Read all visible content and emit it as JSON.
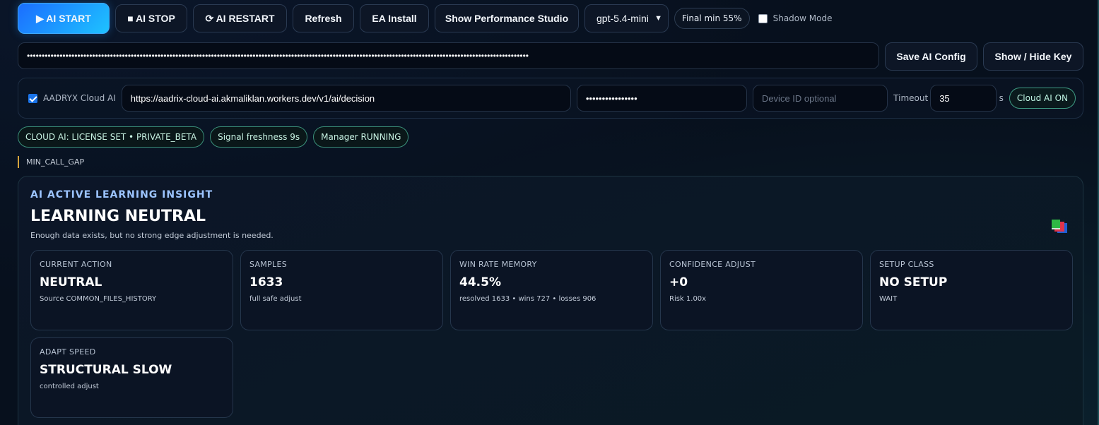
{
  "toolbar": {
    "start_label": "▶ AI START",
    "stop_label": "■ AI STOP",
    "restart_label": "⟳ AI RESTART",
    "refresh_label": "Refresh",
    "ea_install_label": "EA Install",
    "performance_label": "Show Performance Studio",
    "model_select_value": "gpt-5.4-mini",
    "final_min_label": "Final min 55%",
    "shadow_mode_label": "Shadow Mode",
    "shadow_mode_checked": false
  },
  "api_key": {
    "masked_value": "•••••••••••••••••••••••••••••••••••••••••••••••••••••••••••••••••••••••••••••••••••••••••••••••••••••••••••••••••••••••••••••••••••••••••••••••••••••••••••••••••••••••••",
    "save_label": "Save AI Config",
    "toggle_label": "Show / Hide Key"
  },
  "cloud": {
    "enabled_label": "AADRYX Cloud AI",
    "enabled": true,
    "url_value": "https://aadrix-cloud-ai.akmaliklan.workers.dev/v1/ai/decision",
    "license_masked": "••••••••••••••••",
    "device_placeholder": "Device ID optional",
    "timeout_label": "Timeout",
    "timeout_value": "35",
    "timeout_unit": "s",
    "status_label": "Cloud AI ON"
  },
  "status_pills": [
    "CLOUD AI: LICENSE SET • PRIVATE_BETA",
    "Signal freshness 9s",
    "Manager RUNNING"
  ],
  "gap_note": "MIN_CALL_GAP",
  "insight": {
    "kicker": "AI ACTIVE LEARNING INSIGHT",
    "title": "LEARNING NEUTRAL",
    "description": "Enough data exists, but no strong edge adjustment is needed.",
    "icon": "books-icon",
    "cards": [
      {
        "label": "CURRENT ACTION",
        "value": "NEUTRAL",
        "sub": "Source COMMON_FILES_HISTORY"
      },
      {
        "label": "SAMPLES",
        "value": "1633",
        "sub": "full safe adjust"
      },
      {
        "label": "WIN RATE MEMORY",
        "value": "44.5%",
        "sub": "resolved 1633 • wins 727 • losses 906"
      },
      {
        "label": "CONFIDENCE ADJUST",
        "value": "+0",
        "sub": "Risk 1.00x"
      },
      {
        "label": "SETUP CLASS",
        "value": "NO SETUP",
        "sub": "WAIT"
      },
      {
        "label": "ADAPT SPEED",
        "value": "STRUCTURAL SLOW",
        "sub": "controlled adjust"
      }
    ]
  },
  "colors": {
    "accent_blue": "#1b6dff",
    "accent_cyan": "#1ec3ff",
    "status_green": "#3f9c84",
    "note_amber": "#d6a43c",
    "background": "#07101d"
  }
}
